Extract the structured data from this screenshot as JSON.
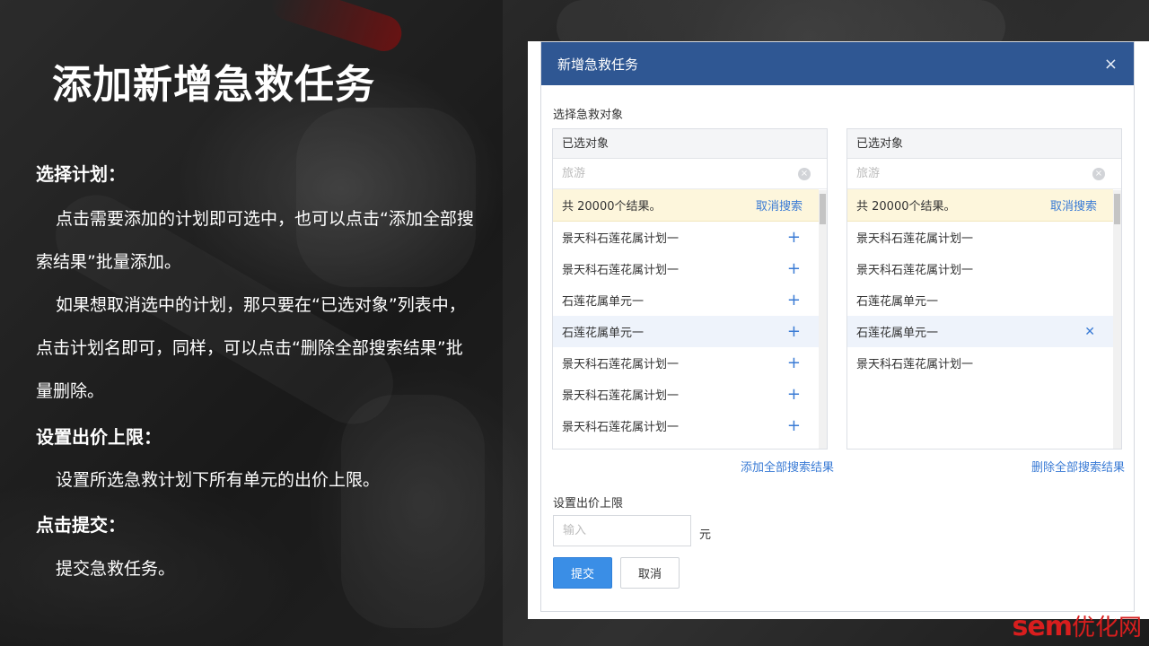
{
  "slide": {
    "title": "添加新增急救任务",
    "sections": [
      {
        "heading": "选择计划：",
        "paragraphs": [
          "点击需要添加的计划即可选中，也可以点击“添加全部搜索结果”批量添加。",
          "如果想取消选中的计划，那只要在“已选对象”列表中，点击计划名即可，同样，可以点击“删除全部搜索结果”批量删除。"
        ]
      },
      {
        "heading": "设置出价上限：",
        "paragraphs": [
          "设置所选急救计划下所有单元的出价上限。"
        ]
      },
      {
        "heading": "点击提交：",
        "paragraphs": [
          "提交急救任务。"
        ]
      }
    ]
  },
  "dialog": {
    "title": "新增急救任务",
    "close_icon": "×",
    "select_label": "选择急救对象",
    "left_panel": {
      "header": "已选对象",
      "search_placeholder": "旅游",
      "result_text": "共 20000个结果。",
      "cancel_search": "取消搜索",
      "items": [
        "景天科石莲花属计划一",
        "景天科石莲花属计划一",
        "石莲花属单元一",
        "石莲花属单元一",
        "景天科石莲花属计划一",
        "景天科石莲花属计划一",
        "景天科石莲花属计划一"
      ],
      "add_all": "添加全部搜索结果"
    },
    "right_panel": {
      "header": "已选对象",
      "search_placeholder": "旅游",
      "result_text": "共 20000个结果。",
      "cancel_search": "取消搜索",
      "items": [
        "景天科石莲花属计划一",
        "景天科石莲花属计划一",
        "石莲花属单元一",
        "石莲花属单元一",
        "景天科石莲花属计划一"
      ],
      "delete_all": "删除全部搜索结果"
    },
    "bid_label": "设置出价上限",
    "bid_placeholder": "输入",
    "bid_unit": "元",
    "submit_label": "提交",
    "cancel_label": "取消"
  },
  "watermark": {
    "brand": "sem",
    "cn": "优化网"
  },
  "colors": {
    "header_blue": "#2f5793",
    "link_blue": "#3a7bd5",
    "submit_blue": "#3a8ee6",
    "result_bg": "#fdf6dc",
    "watermark_red": "#d81e1e"
  }
}
